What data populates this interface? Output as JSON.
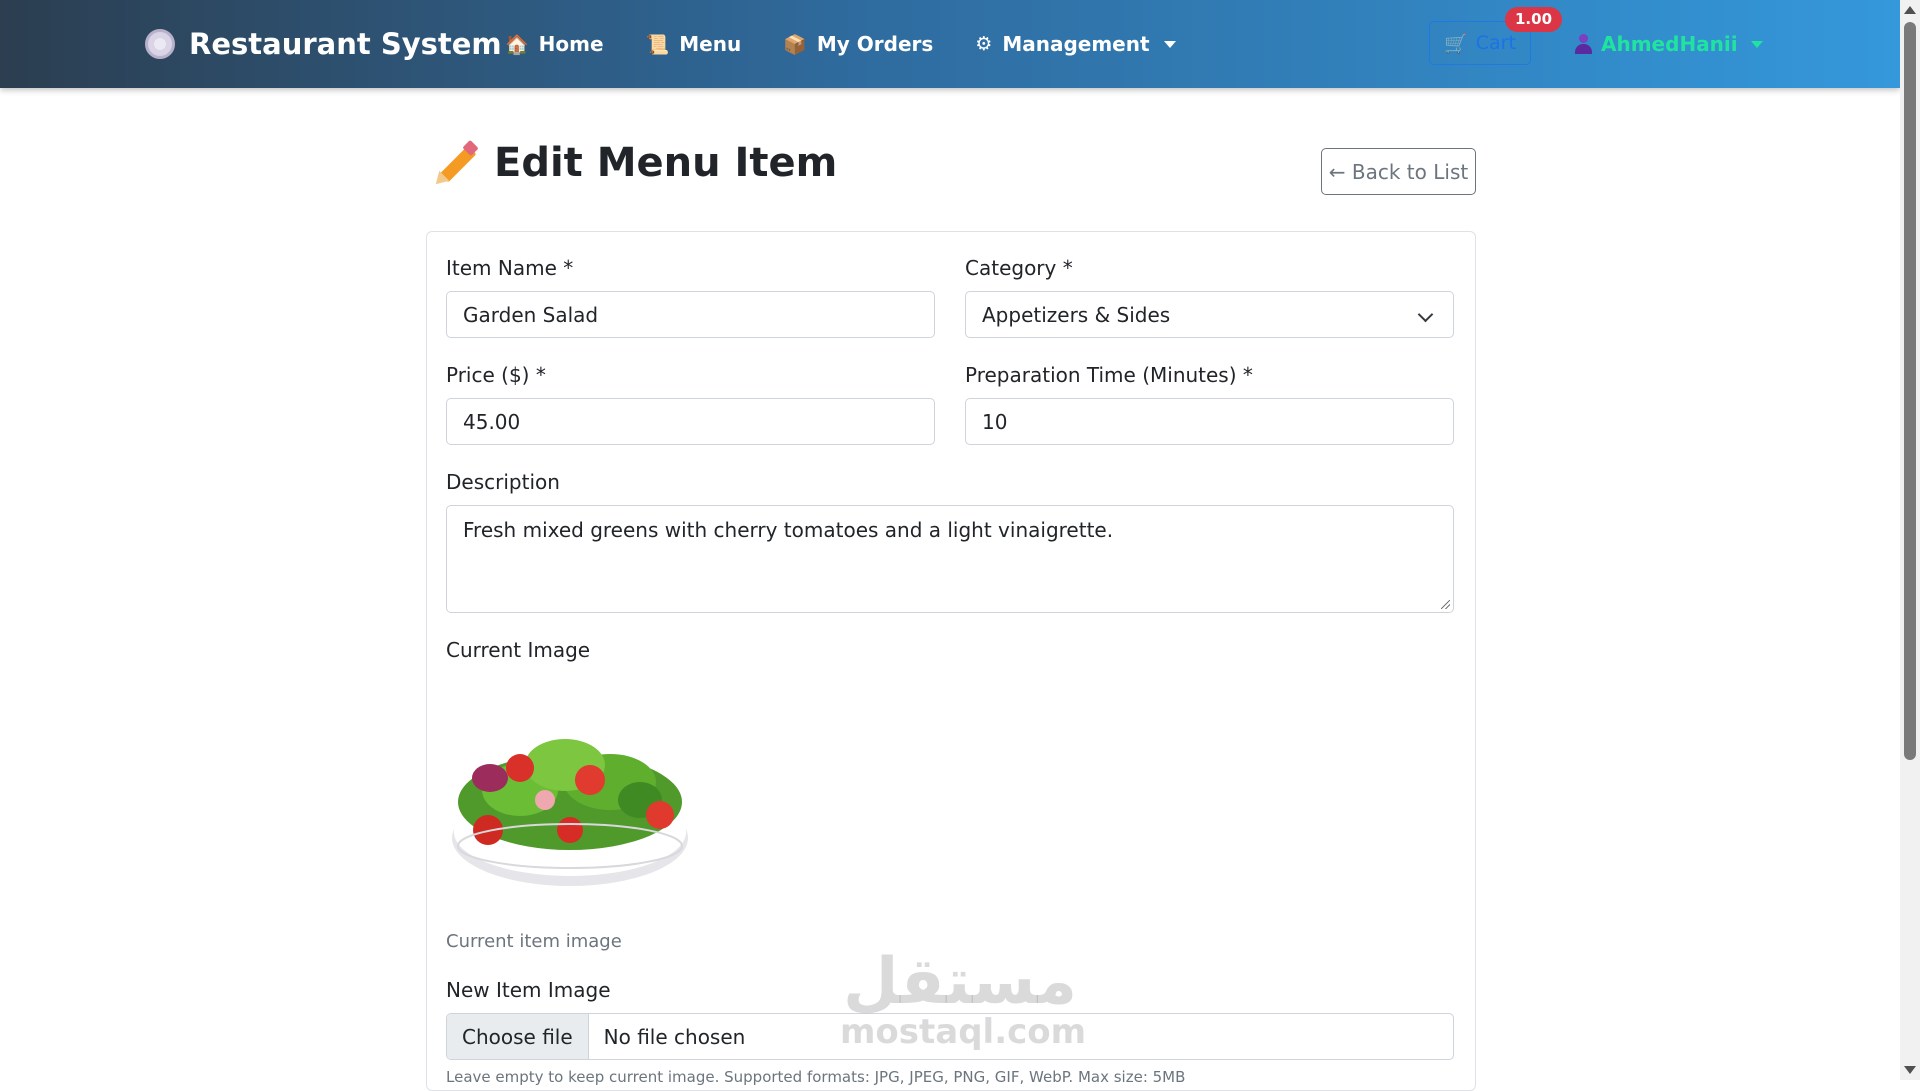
{
  "navbar": {
    "brand": "Restaurant System",
    "links": [
      {
        "label": "Home",
        "icon": "house-icon"
      },
      {
        "label": "Menu",
        "icon": "scroll-icon"
      },
      {
        "label": "My Orders",
        "icon": "package-icon"
      },
      {
        "label": "Management",
        "icon": "gear-icon"
      }
    ],
    "cart": {
      "label": "Cart",
      "badge": "1.00"
    },
    "user": "AhmedHanii"
  },
  "page": {
    "title": "Edit Menu Item",
    "back_button": "← Back to List"
  },
  "form": {
    "item_name": {
      "label": "Item Name *",
      "value": "Garden Salad"
    },
    "category": {
      "label": "Category *",
      "value": "Appetizers & Sides"
    },
    "price": {
      "label": "Price ($) *",
      "value": "45.00"
    },
    "prep_time": {
      "label": "Preparation Time (Minutes) *",
      "value": "10"
    },
    "description": {
      "label": "Description",
      "value": "Fresh mixed greens with cherry tomatoes and a light vinaigrette."
    },
    "current_image": {
      "label": "Current Image",
      "caption": "Current item image"
    },
    "new_image": {
      "label": "New Item Image",
      "button": "Choose file",
      "status": "No file chosen",
      "hint": "Leave empty to keep current image. Supported formats: JPG, JPEG, PNG, GIF, WebP. Max size: 5MB"
    }
  },
  "watermark": {
    "arabic": "مستقل",
    "latin": "mostaql.com"
  },
  "colors": {
    "navbar_start": "#2c3e50",
    "navbar_end": "#3498db",
    "badge": "#dc3545",
    "user": "#20e3a0"
  }
}
